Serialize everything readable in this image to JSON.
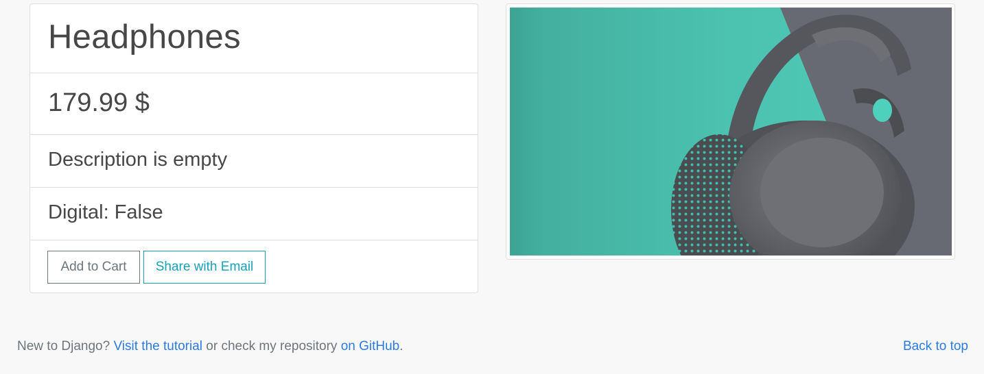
{
  "product": {
    "title": "Headphones",
    "price": "179.99 $",
    "description": "Description is empty",
    "digital": "Digital: False"
  },
  "actions": {
    "add_to_cart": "Add to Cart",
    "share_email": "Share with Email"
  },
  "image": {
    "alt": "Headphones"
  },
  "footer": {
    "prefix": "New to Django? ",
    "tutorial_link": "Visit the tutorial",
    "middle": " or check my repository ",
    "github_link": "on GitHub",
    "suffix": ".",
    "back_to_top": "Back to top"
  },
  "colors": {
    "link": "#2a7ae2",
    "info": "#17a2b8",
    "secondary": "#6c757d",
    "teal_bg": "#4ecab8",
    "gray_bg": "#676a72"
  }
}
